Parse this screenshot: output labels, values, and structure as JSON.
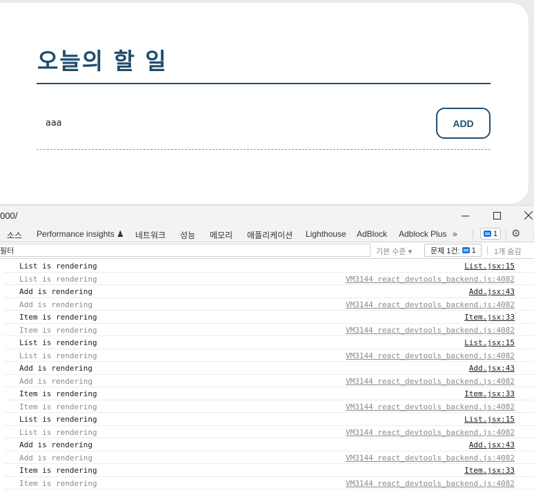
{
  "app": {
    "title": "오늘의 할 일",
    "input_value": "aaa",
    "add_label": "ADD"
  },
  "devtools": {
    "url": "000/",
    "tabs": [
      "소스",
      "Performance insights ♟",
      "네트워크",
      "성능",
      "메모리",
      "애플리케이션",
      "Lighthouse",
      "AdBlock",
      "Adblock Plus",
      "»"
    ],
    "issues_badge_count": "1",
    "filter_placeholder": "필터",
    "level_select": "기본 수준 ▾",
    "issues_label": "문제 1건:",
    "issues_count": "1",
    "hidden_count": "1개 숨김",
    "logs": [
      {
        "msg": "List is rendering",
        "src": "List.jsx:15",
        "dim": false
      },
      {
        "msg": "List is rendering",
        "src": "VM3144 react_devtools_backend.js:4082",
        "dim": true
      },
      {
        "msg": "Add is rendering",
        "src": "Add.jsx:43",
        "dim": false
      },
      {
        "msg": "Add is rendering",
        "src": "VM3144 react_devtools_backend.js:4082",
        "dim": true
      },
      {
        "msg": "Item is rendering",
        "src": "Item.jsx:33",
        "dim": false
      },
      {
        "msg": "Item is rendering",
        "src": "VM3144 react_devtools_backend.js:4082",
        "dim": true
      },
      {
        "msg": "List is rendering",
        "src": "List.jsx:15",
        "dim": false
      },
      {
        "msg": "List is rendering",
        "src": "VM3144 react_devtools_backend.js:4082",
        "dim": true
      },
      {
        "msg": "Add is rendering",
        "src": "Add.jsx:43",
        "dim": false
      },
      {
        "msg": "Add is rendering",
        "src": "VM3144 react_devtools_backend.js:4082",
        "dim": true
      },
      {
        "msg": "Item is rendering",
        "src": "Item.jsx:33",
        "dim": false
      },
      {
        "msg": "Item is rendering",
        "src": "VM3144 react_devtools_backend.js:4082",
        "dim": true
      },
      {
        "msg": "List is rendering",
        "src": "List.jsx:15",
        "dim": false
      },
      {
        "msg": "List is rendering",
        "src": "VM3144 react_devtools_backend.js:4082",
        "dim": true
      },
      {
        "msg": "Add is rendering",
        "src": "Add.jsx:43",
        "dim": false
      },
      {
        "msg": "Add is rendering",
        "src": "VM3144 react_devtools_backend.js:4082",
        "dim": true
      },
      {
        "msg": "Item is rendering",
        "src": "Item.jsx:33",
        "dim": false
      },
      {
        "msg": "Item is rendering",
        "src": "VM3144 react_devtools_backend.js:4082",
        "dim": true
      }
    ]
  },
  "colors": {
    "brand": "#1f4d6e",
    "accent_blue": "#1a73e8"
  }
}
